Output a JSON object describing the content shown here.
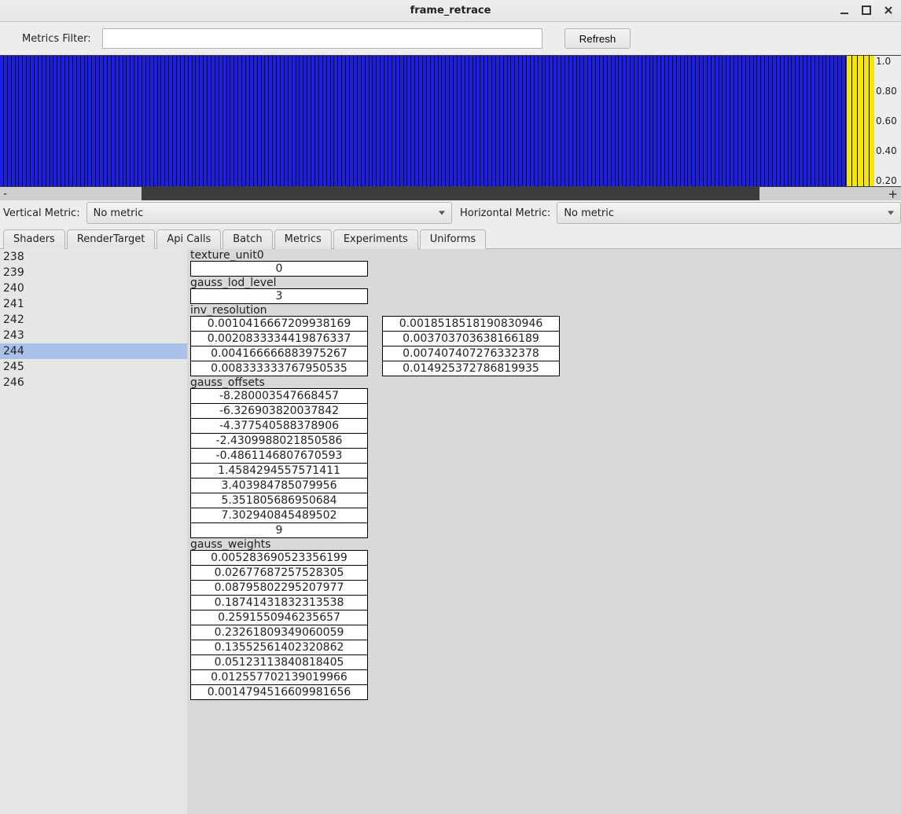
{
  "window": {
    "title": "frame_retrace"
  },
  "toolbar": {
    "metrics_filter_label": "Metrics Filter:",
    "metrics_filter_value": "",
    "refresh_label": "Refresh"
  },
  "bargraph": {
    "axis_ticks": [
      "1.0",
      "0.80",
      "0.60",
      "0.40",
      "0.20"
    ]
  },
  "scroll": {
    "minus": "-",
    "plus": "+"
  },
  "metric_selects": {
    "vertical_label": "Vertical Metric:",
    "vertical_value": "No metric",
    "horizontal_label": "Horizontal Metric:",
    "horizontal_value": "No metric"
  },
  "tabs": [
    "Shaders",
    "RenderTarget",
    "Api Calls",
    "Batch",
    "Metrics",
    "Experiments",
    "Uniforms"
  ],
  "active_tab": "Uniforms",
  "id_list": {
    "ids": [
      "238",
      "239",
      "240",
      "241",
      "242",
      "243",
      "244",
      "245",
      "246"
    ],
    "selected": "244"
  },
  "uniforms": {
    "texture_unit0": {
      "label": "texture_unit0",
      "value": "0"
    },
    "gauss_lod_level": {
      "label": "gauss_lod_level",
      "value": "3"
    },
    "inv_resolution": {
      "label": "inv_resolution",
      "rows": [
        [
          "0.0010416667209938169",
          "0.0018518518190830946"
        ],
        [
          "0.0020833334419876337",
          "0.003703703638166189"
        ],
        [
          "0.004166666883975267",
          "0.007407407276332378"
        ],
        [
          "0.008333333767950535",
          "0.014925372786819935"
        ]
      ]
    },
    "gauss_offsets": {
      "label": "gauss_offsets",
      "values": [
        "-8.280003547668457",
        "-6.326903820037842",
        "-4.377540588378906",
        "-2.4309988021850586",
        "-0.4861146807670593",
        "1.4584294557571411",
        "3.403984785079956",
        "5.351805686950684",
        "7.302940845489502",
        "9"
      ]
    },
    "gauss_weights": {
      "label": "gauss_weights",
      "values": [
        "0.005283690523356199",
        "0.02677687257528305",
        "0.08795802295207977",
        "0.18741431832313538",
        "0.2591550946235657",
        "0.23261809349060059",
        "0.13552561402320862",
        "0.05123113840818405",
        "0.012557702139019966",
        "0.0014794516609981656"
      ]
    }
  }
}
